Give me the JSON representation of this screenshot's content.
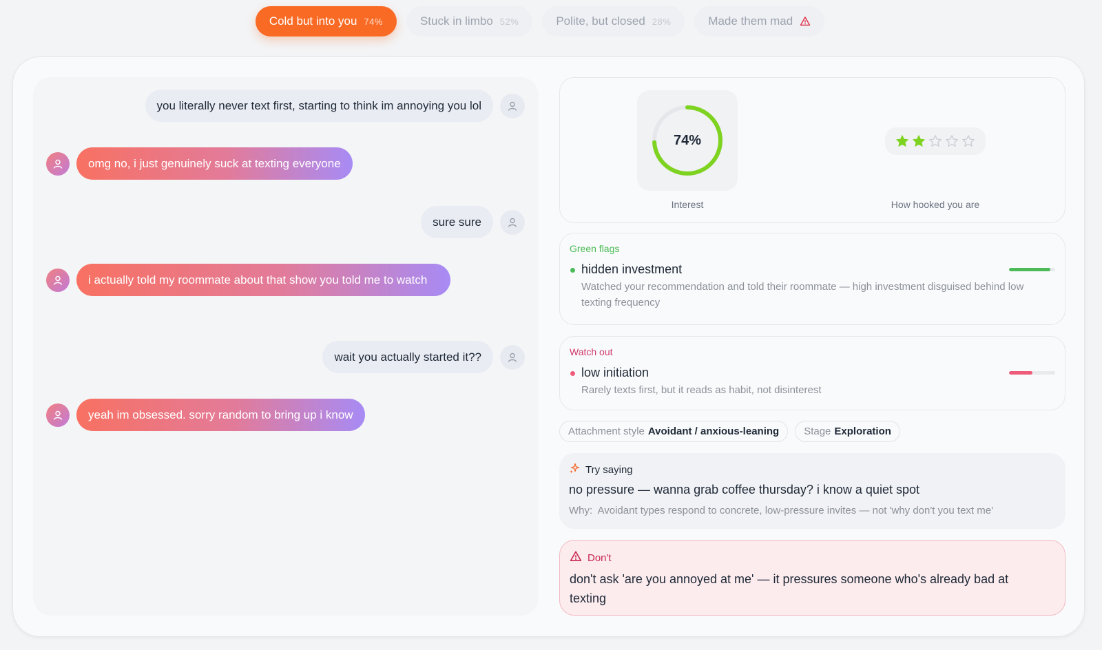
{
  "tabs": [
    {
      "label": "Cold but into you",
      "pct": "74%"
    },
    {
      "label": "Stuck in limbo",
      "pct": "52%"
    },
    {
      "label": "Polite, but closed",
      "pct": "28%"
    },
    {
      "label": "Made them mad",
      "pct": ""
    }
  ],
  "chat": {
    "messages": [
      {
        "from": "me",
        "text": "you literally never text first, starting to think im annoying you lol"
      },
      {
        "from": "them",
        "text": "omg no, i just genuinely suck at texting everyone"
      },
      {
        "from": "me",
        "text": "sure sure"
      },
      {
        "from": "them",
        "text": "i actually told my roommate about that show you told me to watch"
      },
      {
        "from": "me",
        "text": "wait you actually started it??"
      },
      {
        "from": "them",
        "text": "yeah im obsessed. sorry random to bring up i know"
      }
    ]
  },
  "score": {
    "interest_value": "74%",
    "interest_fraction": 0.74,
    "interest_label": "Interest",
    "gauge_color": "#7ed321",
    "stars_filled": 2,
    "stars_total": 5,
    "star_color": "#7ed321",
    "stars_label": "How hooked you are"
  },
  "green_flags": {
    "title": "Green flags",
    "items": [
      {
        "name": "hidden investment",
        "desc": "Watched your recommendation and told their roommate — high investment disguised behind low texting frequency",
        "level": 0.9,
        "color": "#4cbb57"
      }
    ]
  },
  "watch_out": {
    "title": "Watch out",
    "items": [
      {
        "name": "low initiation",
        "desc": "Rarely texts first, but it reads as habit, not disinterest",
        "level": 0.5,
        "color": "#ef5b7a"
      }
    ]
  },
  "chips": {
    "attachment_key": "Attachment style",
    "attachment_value": "Avoidant / anxious-leaning",
    "stage_key": "Stage",
    "stage_value": "Exploration"
  },
  "try_saying": {
    "title": "Try saying",
    "text": "no pressure — wanna grab coffee thursday? i know a quiet spot",
    "why_label": "Why:",
    "why_text": "Avoidant types respond to concrete, low-pressure invites — not 'why don't you text me'"
  },
  "dont": {
    "title": "Don't",
    "text": "don't ask 'are you annoyed at me' — it pressures someone who's already bad at texting"
  }
}
